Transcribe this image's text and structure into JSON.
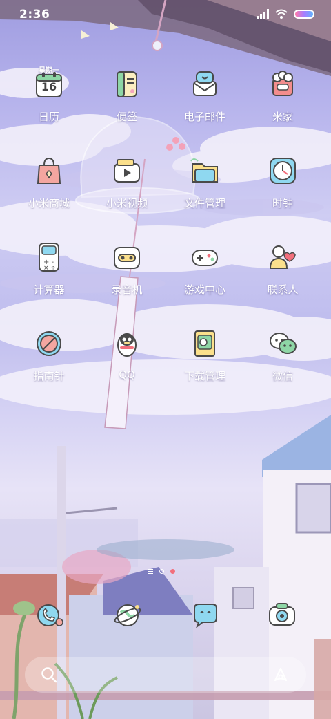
{
  "status_bar": {
    "time": "2:36",
    "icons": [
      "signal-icon",
      "wifi-icon",
      "battery-icon"
    ]
  },
  "calendar_widget": {
    "weekday": "星期一",
    "date": "16"
  },
  "apps": [
    {
      "label": "日历",
      "icon": "calendar-icon"
    },
    {
      "label": "便签",
      "icon": "notes-icon"
    },
    {
      "label": "电子邮件",
      "icon": "email-icon"
    },
    {
      "label": "米家",
      "icon": "mijia-icon"
    },
    {
      "label": "小米商城",
      "icon": "shopping-bag-icon"
    },
    {
      "label": "小米视频",
      "icon": "video-icon"
    },
    {
      "label": "文件管理",
      "icon": "folder-icon"
    },
    {
      "label": "时钟",
      "icon": "clock-icon"
    },
    {
      "label": "计算器",
      "icon": "calculator-icon"
    },
    {
      "label": "录音机",
      "icon": "recorder-icon"
    },
    {
      "label": "游戏中心",
      "icon": "gamepad-icon"
    },
    {
      "label": "联系人",
      "icon": "contacts-icon"
    },
    {
      "label": "指南针",
      "icon": "compass-icon"
    },
    {
      "label": "QQ",
      "icon": "qq-penguin-icon"
    },
    {
      "label": "下载管理",
      "icon": "download-icon"
    },
    {
      "label": "微信",
      "icon": "wechat-icon"
    }
  ],
  "page_indicator": {
    "pages": 3,
    "current": 3
  },
  "dock": [
    {
      "icon": "phone-icon"
    },
    {
      "icon": "browser-icon"
    },
    {
      "icon": "messages-icon"
    },
    {
      "icon": "camera-icon"
    }
  ],
  "search_bar": {
    "search_icon": "search-icon",
    "assistant_icon": "assistant-icon"
  },
  "colors": {
    "accent_pink": "#f26f7c",
    "label_text": "#ffffff",
    "icon_outline": "#4a4a4a"
  }
}
